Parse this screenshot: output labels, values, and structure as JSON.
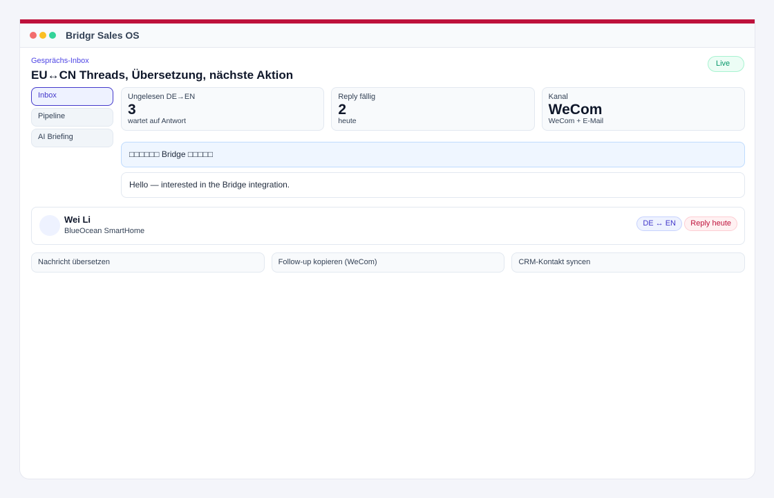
{
  "app": {
    "title": "Bridgr Sales OS"
  },
  "header": {
    "section_label": "Gesprächs-Inbox",
    "title": "EU↔CN Threads, Übersetzung, nächste Aktion",
    "status_badge": "Live"
  },
  "nav": {
    "items": [
      {
        "label": "Inbox",
        "active": true
      },
      {
        "label": "Pipeline",
        "active": false
      },
      {
        "label": "AI Briefing",
        "active": false
      }
    ]
  },
  "stats": [
    {
      "label": "Ungelesen DE→EN",
      "value": "3",
      "sub": "wartet auf Antwort"
    },
    {
      "label": "Reply fällig",
      "value": "2",
      "sub": "heute"
    },
    {
      "label": "Kanal",
      "value": "WeCom",
      "sub": "WeCom + E-Mail"
    }
  ],
  "thread": {
    "original": "□□□□□□ Bridge □□□□□",
    "translation": "Hello — interested in the Bridge integration."
  },
  "contact": {
    "name": "Wei Li",
    "company": "BlueOcean SmartHome",
    "lang_tag": "DE ↔ EN",
    "reply_tag": "Reply heute"
  },
  "actions": [
    {
      "label": "Nachricht übersetzen"
    },
    {
      "label": "Follow-up kopieren (WeCom)"
    },
    {
      "label": "CRM-Kontakt syncen"
    }
  ],
  "colors": {
    "accent": "#be123c",
    "primary": "#4338ca",
    "success": "#059669"
  }
}
